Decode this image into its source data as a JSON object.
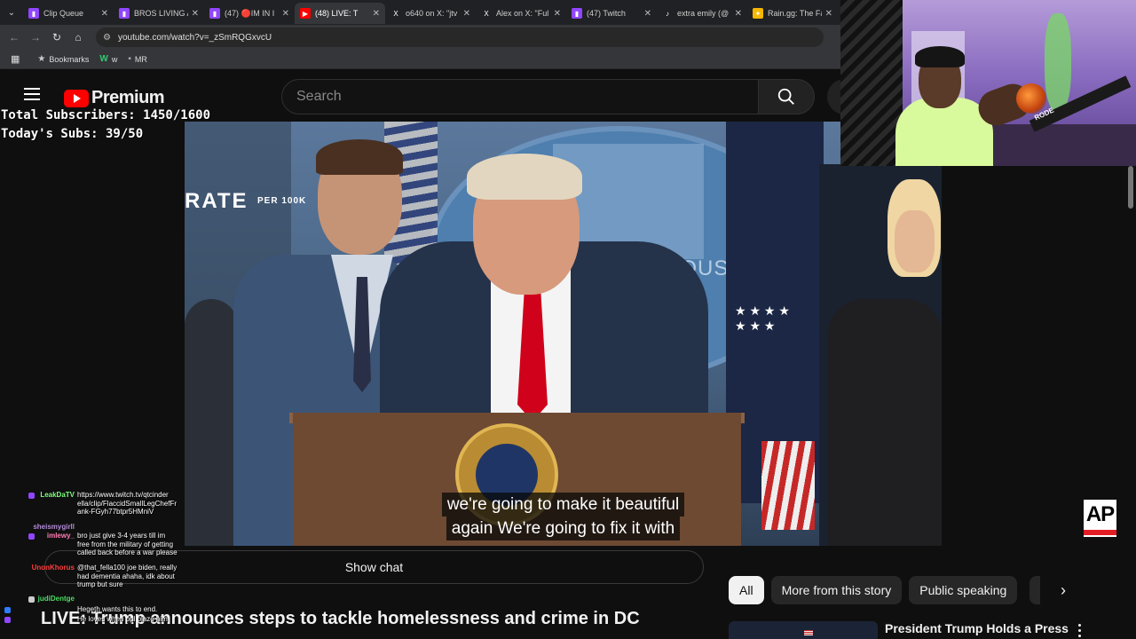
{
  "browser": {
    "tabs": [
      {
        "label": "Clip Queue",
        "icon": "twitch-icon",
        "color": "#9146ff"
      },
      {
        "label": "BROS LIVING A",
        "icon": "twitch-icon",
        "color": "#9146ff"
      },
      {
        "label": "(47) 🔴IM IN I",
        "icon": "twitch-icon",
        "color": "#9146ff"
      },
      {
        "label": "(48) LIVE: T",
        "icon": "youtube-icon",
        "color": "#ff0000",
        "active": true
      },
      {
        "label": "o640 on X: \"jtv",
        "icon": "x-icon",
        "color": "#000000"
      },
      {
        "label": "Alex on X: \"Ful",
        "icon": "x-icon",
        "color": "#000000"
      },
      {
        "label": "(47) Twitch",
        "icon": "twitch-icon",
        "color": "#9146ff"
      },
      {
        "label": "extra emily (@",
        "icon": "tiktok-icon",
        "color": "#000000"
      },
      {
        "label": "Rain.gg: The Fa",
        "icon": "rain-icon",
        "color": "#f5b700"
      }
    ],
    "url": "youtube.com/watch?v=_zSmRQGxvcU",
    "bookmarks": [
      {
        "label": "Bookmarks",
        "icon": "star-icon"
      },
      {
        "label": "w",
        "icon": "w-icon"
      },
      {
        "label": "MR",
        "icon": "folder-icon"
      }
    ]
  },
  "youtube": {
    "brand": "Premium",
    "search_placeholder": "Search"
  },
  "overlay": {
    "total_subs": "Total Subscribers: 1450/1600",
    "todays_subs": "Today's Subs: 39/50"
  },
  "video": {
    "wall_text": "RATE",
    "wall_subtext": "PER 100K",
    "house_text": "HOUSE",
    "caption_line1": "we're going to make it beautiful",
    "caption_line2": "again We're going to fix it with",
    "watermark": "AP"
  },
  "webcam": {
    "mic_brand": "RODE"
  },
  "chat": {
    "messages": [
      {
        "user": "LeakDaTV",
        "color": "#7cff7c",
        "badge_color": "#9146ff",
        "text": "https://www.twitch.tv/qtcinder\nella/clip/FlaccidSmallLegChefFr\nank-FGyh77btpr5HMniV"
      },
      {
        "user": "sheismygirll",
        "color": "#b28bd9",
        "badge_color": "",
        "text": ""
      },
      {
        "user": "imlewy_",
        "color": "#ff7eb6",
        "badge_color": "#9146ff",
        "text": "bro just give 3-4 years till im\nfree from the military of getting\ncalled back before a war please"
      },
      {
        "user": "UnonKhorus",
        "color": "#ff3b3b",
        "badge_color": "",
        "text": "@that_fella100 joe biden, really\nhad dementia ahaha, idk about\ntrump but sure"
      },
      {
        "user": "judiDentge",
        "color": "#4cd964",
        "badge_color": "#cccccc",
        "text": ""
      },
      {
        "user": "",
        "color": "#2f7cff",
        "badge_color": "#2f7cff",
        "text": "Hegeth wants this to end."
      },
      {
        "user": "",
        "color": "#9146ff",
        "badge_color": "#9146ff",
        "text": "He loves when ppl blaze him"
      }
    ]
  },
  "show_chat": "Show chat",
  "title": "LIVE: Trump announces steps to tackle homelessness and crime in DC",
  "chips": [
    "All",
    "More from this story",
    "Public speaking"
  ],
  "recommendation": {
    "title": "President Trump Holds a Press"
  }
}
